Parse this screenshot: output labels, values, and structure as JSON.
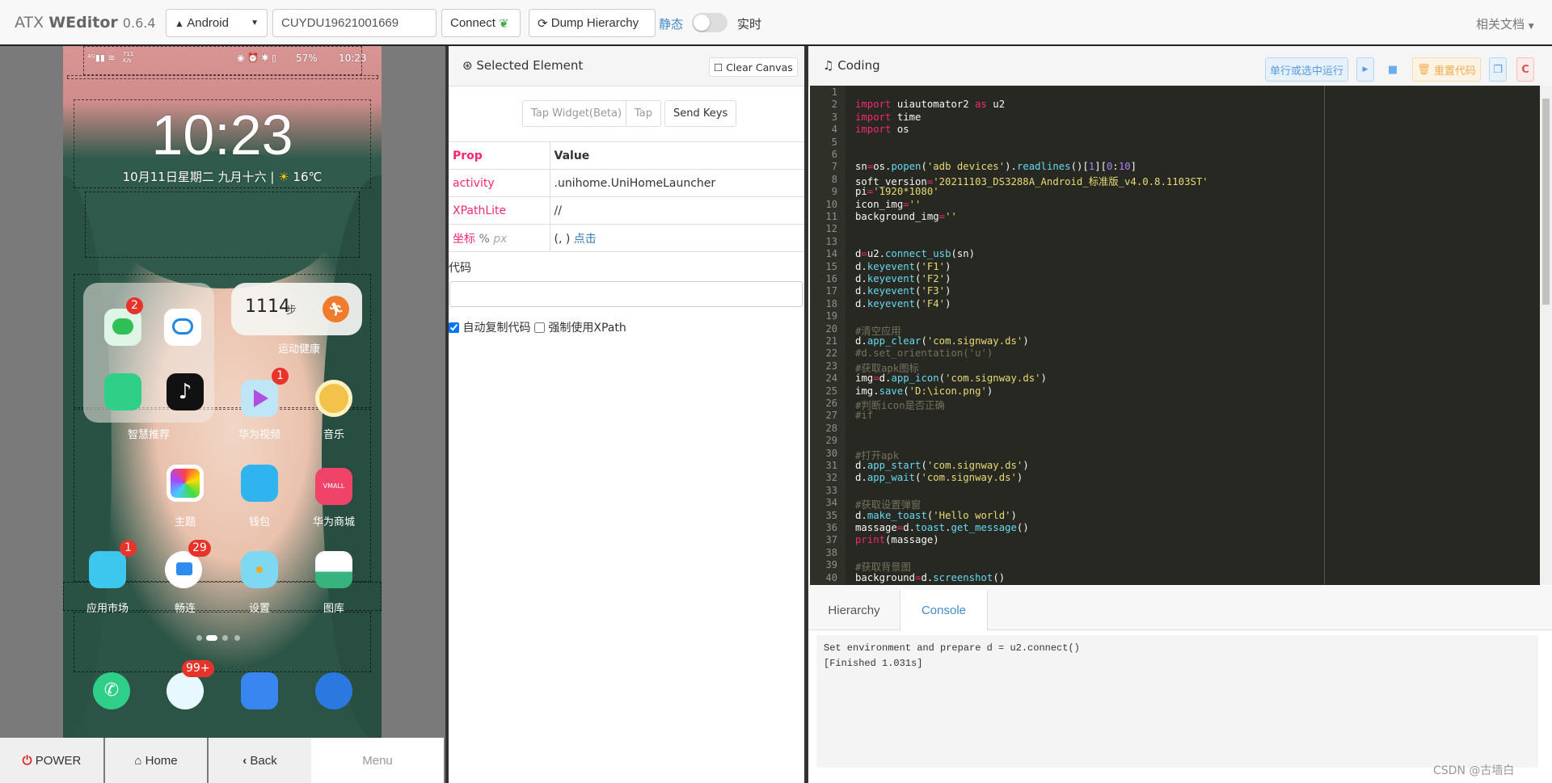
{
  "topbar": {
    "brand_prefix": "ATX ",
    "brand_name": "WEditor",
    "version": "0.6.4",
    "platform": "Android",
    "serial": "CUYDU19621001669",
    "connect": "Connect",
    "dump": "Dump Hierarchy",
    "static": "静态",
    "realtime": "实时",
    "docs": "相关文档"
  },
  "phone": {
    "status_time": "10:23",
    "status_battery": "57%",
    "status_speed": "711 K/s",
    "clock": "10:23",
    "date": "10月11日星期二  九月十六",
    "temp": "16℃",
    "steps": "1114",
    "steps_unit": "步",
    "labels": {
      "folder": "智慧推荐",
      "health": "运动健康",
      "video": "华为视频",
      "music": "音乐",
      "theme": "主题",
      "wallet": "钱包",
      "vmall": "华为商城",
      "appmarket": "应用市场",
      "meetime": "畅连",
      "settings": "设置",
      "gallery": "图库",
      "vmall_icon": "VMALL"
    },
    "badges": {
      "wechat": "2",
      "video": "1",
      "appmarket": "1",
      "meetime": "29",
      "messages": "99+"
    }
  },
  "nav": {
    "power": "POWER",
    "home": "Home",
    "back": "Back",
    "menu": "Menu"
  },
  "selected": {
    "title": "Selected Element",
    "clear": "Clear Canvas",
    "tap_widget": "Tap Widget(Beta)",
    "tap": "Tap",
    "send_keys": "Send Keys",
    "col_prop": "Prop",
    "col_value": "Value",
    "rows": [
      {
        "prop": "activity",
        "value": ".unihome.UniHomeLauncher"
      },
      {
        "prop": "XPathLite",
        "value": "//"
      }
    ],
    "coord_label": "坐标",
    "coord_pct": "%",
    "coord_px": "px",
    "coord_value": "(, )",
    "coord_click": "点击",
    "code_label": "代码",
    "code_value": "",
    "auto_copy": "自动复制代码",
    "auto_copy_checked": true,
    "force_xpath": "强制使用XPath",
    "force_xpath_checked": false
  },
  "coding": {
    "title": "Coding",
    "run_line": "单行或选中运行",
    "reset": "重置代码",
    "reload": "C",
    "lines": [
      [],
      [
        [
          "k",
          "import"
        ],
        [
          "",
          " uiautomator2 "
        ],
        [
          "k",
          "as"
        ],
        [
          "",
          " u2"
        ]
      ],
      [
        [
          "k",
          "import"
        ],
        [
          "",
          " time"
        ]
      ],
      [
        [
          "k",
          "import"
        ],
        [
          "",
          " os"
        ]
      ],
      [],
      [],
      [
        [
          "",
          "sn"
        ],
        [
          "o",
          "="
        ],
        [
          "",
          "os."
        ],
        [
          "f",
          "popen"
        ],
        [
          "",
          "("
        ],
        [
          "s",
          "'adb devices'"
        ],
        [
          "",
          ")."
        ],
        [
          "f",
          "readlines"
        ],
        [
          "",
          "()["
        ],
        [
          "n",
          "1"
        ],
        [
          "",
          "]["
        ],
        [
          "n",
          "0"
        ],
        [
          "",
          ":"
        ],
        [
          "n",
          "10"
        ],
        [
          "",
          "]"
        ]
      ],
      [
        [
          "",
          "soft_version"
        ],
        [
          "o",
          "="
        ],
        [
          "s",
          "'20211103_DS3288A_Android_标准版_v4.0.8.1103ST'"
        ]
      ],
      [
        [
          "",
          "pi"
        ],
        [
          "o",
          "="
        ],
        [
          "s",
          "'1920*1080'"
        ]
      ],
      [
        [
          "",
          "icon_img"
        ],
        [
          "o",
          "="
        ],
        [
          "s",
          "''"
        ]
      ],
      [
        [
          "",
          "background_img"
        ],
        [
          "o",
          "="
        ],
        [
          "s",
          "''"
        ]
      ],
      [],
      [],
      [
        [
          "",
          "d"
        ],
        [
          "o",
          "="
        ],
        [
          "",
          "u2."
        ],
        [
          "f",
          "connect_usb"
        ],
        [
          "",
          "(sn)"
        ]
      ],
      [
        [
          "",
          "d."
        ],
        [
          "f",
          "keyevent"
        ],
        [
          "",
          "("
        ],
        [
          "s",
          "'F1'"
        ],
        [
          "",
          ")"
        ]
      ],
      [
        [
          "",
          "d."
        ],
        [
          "f",
          "keyevent"
        ],
        [
          "",
          "("
        ],
        [
          "s",
          "'F2'"
        ],
        [
          "",
          ")"
        ]
      ],
      [
        [
          "",
          "d."
        ],
        [
          "f",
          "keyevent"
        ],
        [
          "",
          "("
        ],
        [
          "s",
          "'F3'"
        ],
        [
          "",
          ")"
        ]
      ],
      [
        [
          "",
          "d."
        ],
        [
          "f",
          "keyevent"
        ],
        [
          "",
          "("
        ],
        [
          "s",
          "'F4'"
        ],
        [
          "",
          ")"
        ]
      ],
      [],
      [
        [
          "c",
          "#清空应用"
        ]
      ],
      [
        [
          "",
          "d."
        ],
        [
          "f",
          "app_clear"
        ],
        [
          "",
          "("
        ],
        [
          "s",
          "'com.signway.ds'"
        ],
        [
          "",
          ")"
        ]
      ],
      [
        [
          "c",
          "#d.set_orientation('u')"
        ]
      ],
      [
        [
          "c",
          "#获取apk图标"
        ]
      ],
      [
        [
          "",
          "img"
        ],
        [
          "o",
          "="
        ],
        [
          "",
          "d."
        ],
        [
          "f",
          "app_icon"
        ],
        [
          "",
          "("
        ],
        [
          "s",
          "'com.signway.ds'"
        ],
        [
          "",
          ")"
        ]
      ],
      [
        [
          "",
          "img."
        ],
        [
          "f",
          "save"
        ],
        [
          "",
          "("
        ],
        [
          "s",
          "'D:\\icon.png'"
        ],
        [
          "",
          ")"
        ]
      ],
      [
        [
          "c",
          "#判断icon是否正确"
        ]
      ],
      [
        [
          "c",
          "#if"
        ]
      ],
      [],
      [],
      [
        [
          "c",
          "#打开apk"
        ]
      ],
      [
        [
          "",
          "d."
        ],
        [
          "f",
          "app_start"
        ],
        [
          "",
          "("
        ],
        [
          "s",
          "'com.signway.ds'"
        ],
        [
          "",
          ")"
        ]
      ],
      [
        [
          "",
          "d."
        ],
        [
          "f",
          "app_wait"
        ],
        [
          "",
          "("
        ],
        [
          "s",
          "'com.signway.ds'"
        ],
        [
          "",
          ")"
        ]
      ],
      [],
      [
        [
          "c",
          "#获取设置弹窗"
        ]
      ],
      [
        [
          "",
          "d."
        ],
        [
          "f",
          "make_toast"
        ],
        [
          "",
          "("
        ],
        [
          "s",
          "'Hello world'"
        ],
        [
          "",
          ")"
        ]
      ],
      [
        [
          "",
          "massage"
        ],
        [
          "o",
          "="
        ],
        [
          "",
          "d."
        ],
        [
          "f",
          "toast"
        ],
        [
          "",
          "."
        ],
        [
          "f",
          "get_message"
        ],
        [
          "",
          "()"
        ]
      ],
      [
        [
          "k",
          "print"
        ],
        [
          "",
          "(massage)"
        ]
      ],
      [],
      [
        [
          "c",
          "#获取背景图"
        ]
      ],
      [
        [
          "",
          "background"
        ],
        [
          "o",
          "="
        ],
        [
          "",
          "d."
        ],
        [
          "f",
          "screenshot"
        ],
        [
          "",
          "()"
        ]
      ]
    ]
  },
  "tabs": {
    "hierarchy": "Hierarchy",
    "console": "Console",
    "active": "Console"
  },
  "console": {
    "lines": [
      "Set environment and prepare d = u2.connect()",
      "[Finished 1.031s]"
    ]
  },
  "watermark": "CSDN @古墙白",
  "colors": {
    "accent": "#428bca",
    "power": "#e02020",
    "editor_bg": "#272822"
  }
}
